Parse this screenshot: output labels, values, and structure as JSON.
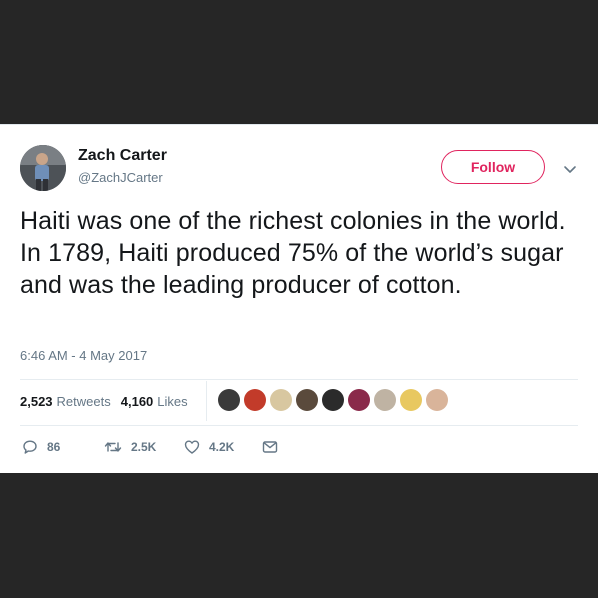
{
  "user": {
    "name": "Zach Carter",
    "handle": "@ZachJCarter"
  },
  "follow_label": "Follow",
  "tweet": {
    "text": "Haiti was one of the richest colonies in the world. In 1789, Haiti produced 75% of the world’s sugar and was the leading producer of cotton.",
    "timestamp": "6:46 AM - 4 May 2017"
  },
  "stats": {
    "retweets_count": "2,523",
    "retweets_label": "Retweets",
    "likes_count": "4,160",
    "likes_label": "Likes"
  },
  "likers": [
    {
      "color": "#3a3a3a"
    },
    {
      "color": "#c23b2a"
    },
    {
      "color": "#d8c7a0"
    },
    {
      "color": "#5a4a3c"
    },
    {
      "color": "#2b2b2b"
    },
    {
      "color": "#8a2a4a"
    },
    {
      "color": "#bfb3a3"
    },
    {
      "color": "#e8c860"
    },
    {
      "color": "#d9b49a"
    }
  ],
  "actions": {
    "replies": "86",
    "retweets": "2.5K",
    "likes": "4.2K"
  },
  "colors": {
    "accent": "#e0245e",
    "text": "#14171a",
    "muted": "#657786",
    "background": "#262626"
  }
}
